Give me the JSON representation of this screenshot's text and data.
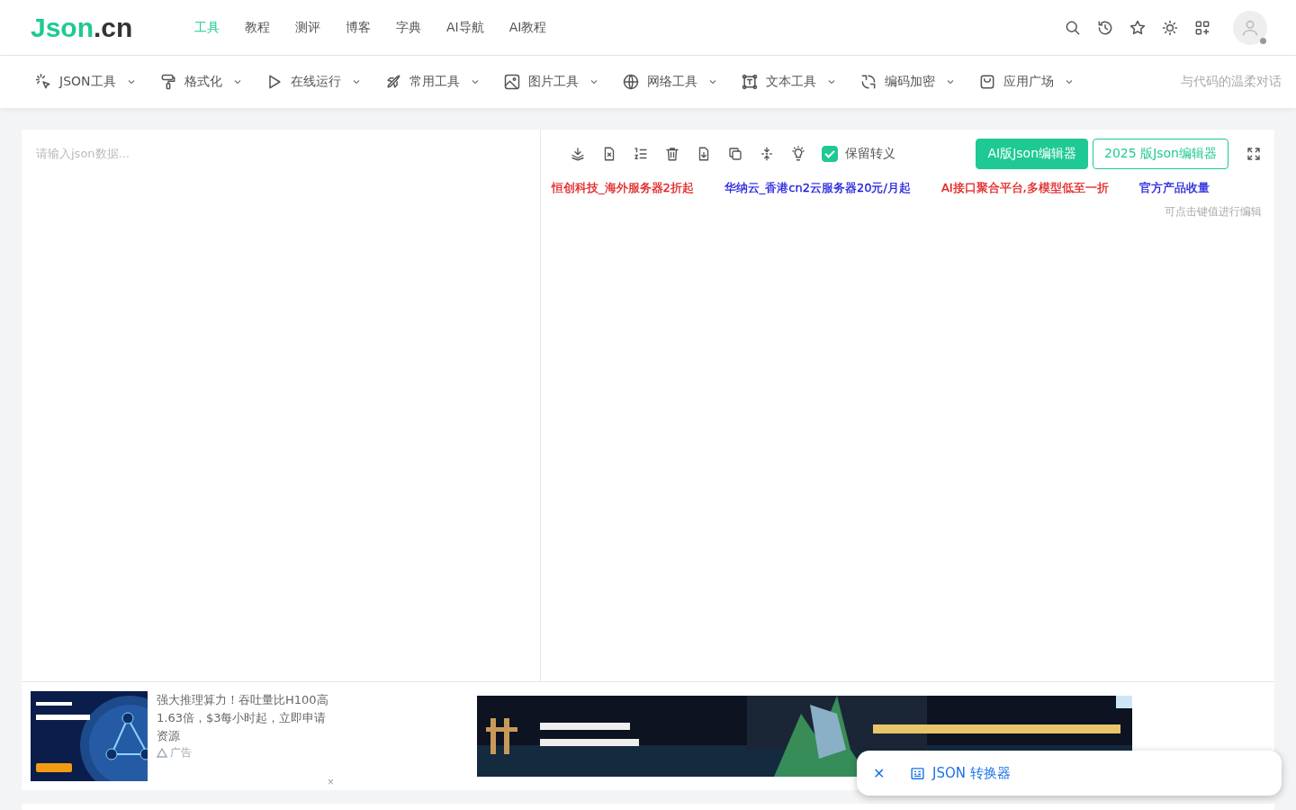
{
  "logo": {
    "main": "Json",
    "suffix": ".cn"
  },
  "top_nav": [
    {
      "label": "工具",
      "selected": true
    },
    {
      "label": "教程",
      "selected": false
    },
    {
      "label": "测评",
      "selected": false
    },
    {
      "label": "博客",
      "selected": false
    },
    {
      "label": "字典",
      "selected": false
    },
    {
      "label": "AI导航",
      "selected": false
    },
    {
      "label": "AI教程",
      "selected": false
    }
  ],
  "tool_menu": [
    {
      "label": "JSON工具"
    },
    {
      "label": "格式化"
    },
    {
      "label": "在线运行"
    },
    {
      "label": "常用工具"
    },
    {
      "label": "图片工具"
    },
    {
      "label": "网络工具"
    },
    {
      "label": "文本工具"
    },
    {
      "label": "编码加密"
    },
    {
      "label": "应用广场"
    }
  ],
  "slogan": "与代码的温柔对话",
  "editor": {
    "placeholder": "请输入json数据..."
  },
  "keep_escape": {
    "label": "保留转义",
    "checked": true
  },
  "buttons": [
    {
      "label": "AI版Json编辑器",
      "kind": "primary"
    },
    {
      "label": "2025 版Json编辑器",
      "kind": "outline"
    }
  ],
  "sponsor_links": [
    {
      "label": "恒创科技_海外服务器2折起",
      "color": "#e02020"
    },
    {
      "label": "华纳云_香港cn2云服务器20元/月起",
      "color": "#1a1adb"
    },
    {
      "label": "AI接口聚合平台,多模型低至一折",
      "color": "#e02020"
    },
    {
      "label": "官方产品收量",
      "color": "#1a1adb"
    }
  ],
  "edit_hint": "可点击键值进行编辑",
  "text_ad": {
    "text": "强大推理算力！吞吐量比H100高1.63倍，$3每小时起，立即申请资源",
    "tag": "广告",
    "close": "×"
  },
  "popup": {
    "close": "✕",
    "label": "JSON 转换器"
  }
}
